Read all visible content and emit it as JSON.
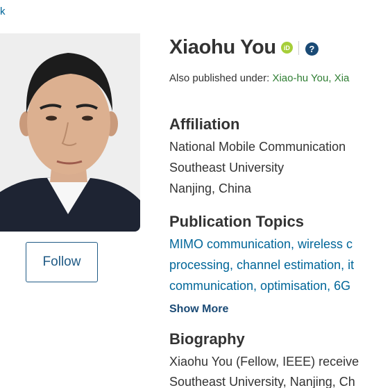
{
  "nav": {
    "back_label": "k"
  },
  "profile": {
    "name": "Xiaohu You",
    "orcid_badge": "iD",
    "help_symbol": "?",
    "follow_label": "Follow",
    "aka_prefix": "Also published under:",
    "aliases": [
      "Xiao-hu You,",
      "Xia"
    ]
  },
  "affiliation": {
    "heading": "Affiliation",
    "lines": [
      "National Mobile Communication",
      "Southeast University",
      "Nanjing, China"
    ]
  },
  "topics": {
    "heading": "Publication Topics",
    "lines": [
      "MIMO communication, wireless c",
      "processing, channel estimation, it",
      "communication, optimisation, 6G"
    ],
    "show_more_label": "Show More"
  },
  "biography": {
    "heading": "Biography",
    "lines": [
      "Xiaohu You (Fellow, IEEE) receive",
      "Southeast University, Nanjing, Ch"
    ]
  },
  "colors": {
    "link": "#006699",
    "alias": "#2e7d32",
    "orcid": "#a6ce39",
    "help": "#1a4a75",
    "button_border": "#1f5a85"
  }
}
